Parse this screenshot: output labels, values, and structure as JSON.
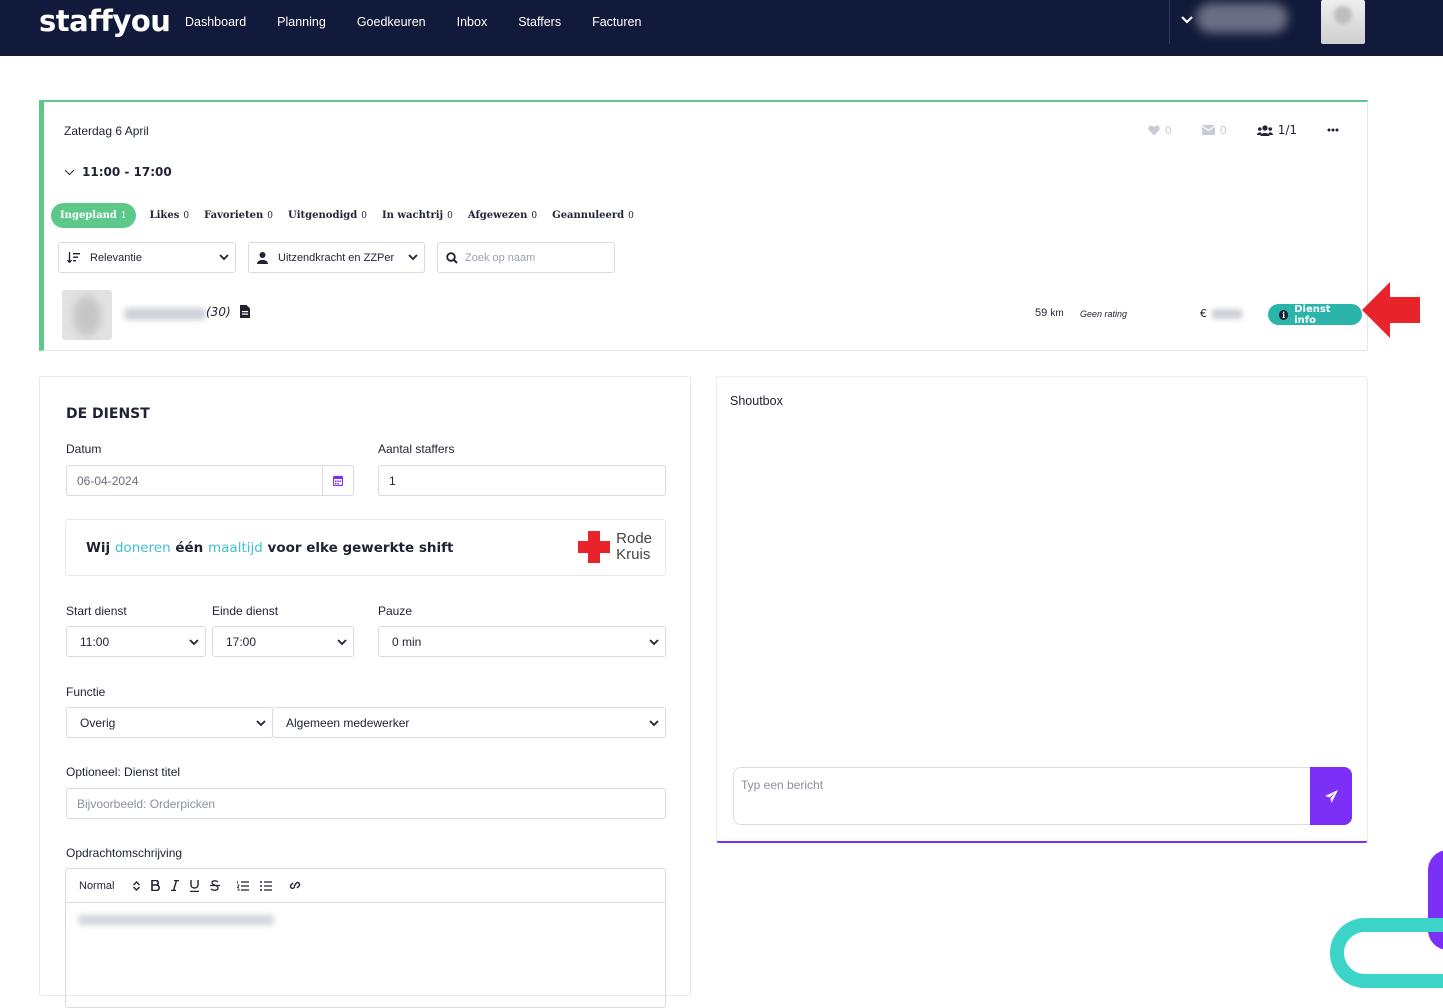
{
  "nav": {
    "logo": "staffyou",
    "links": [
      "Dashboard",
      "Planning",
      "Goedkeuren",
      "Inbox",
      "Staffers",
      "Facturen"
    ]
  },
  "shift": {
    "date": "Zaterdag 6 April",
    "time": "11:00 - 17:00",
    "likes": "0",
    "messages": "0",
    "staff_count": "1/1",
    "tabs": [
      {
        "label": "Ingepland",
        "count": "1"
      },
      {
        "label": "Likes",
        "count": "0"
      },
      {
        "label": "Favorieten",
        "count": "0"
      },
      {
        "label": "Uitgenodigd",
        "count": "0"
      },
      {
        "label": "In wachtrij",
        "count": "0"
      },
      {
        "label": "Afgewezen",
        "count": "0"
      },
      {
        "label": "Geannuleerd",
        "count": "0"
      }
    ],
    "filters": {
      "sort": "Relevantie",
      "type": "Uitzendkracht en ZZPer",
      "search_placeholder": "Zoek op naam"
    },
    "staffer": {
      "age": "(30)",
      "distance": "59",
      "distance_unit": "km",
      "rating": "Geen rating",
      "currency": "€",
      "info_button": "Dienst info"
    }
  },
  "dienst": {
    "title": "DE DIENST",
    "date_label": "Datum",
    "date_value": "06-04-2024",
    "count_label": "Aantal staffers",
    "count_value": "1",
    "donate": {
      "pre": "Wij ",
      "w1": "doneren",
      "mid": " één ",
      "w2": "maaltijd",
      "post": " voor elke gewerkte shift"
    },
    "rk_line1": "Rode",
    "rk_line2": "Kruis",
    "start_label": "Start dienst",
    "start_value": "11:00",
    "end_label": "Einde dienst",
    "end_value": "17:00",
    "pause_label": "Pauze",
    "pause_value": "0 min",
    "function_label": "Functie",
    "function_cat": "Overig",
    "function_value": "Algemeen medewerker",
    "title_label": "Optioneel: Dienst titel",
    "title_placeholder": "Bijvoorbeeld: Orderpicken",
    "desc_label": "Opdrachtomschrijving",
    "editor_style": "Normal"
  },
  "shoutbox": {
    "title": "Shoutbox",
    "placeholder": "Typ een bericht"
  },
  "colors": {
    "nav_bg": "#121a3b",
    "accent_green": "#5cc98a",
    "accent_teal": "#2bb5aa",
    "accent_purple": "#7b2ff7",
    "highlight_blue": "#3fc1d0",
    "red": "#e8232a"
  }
}
